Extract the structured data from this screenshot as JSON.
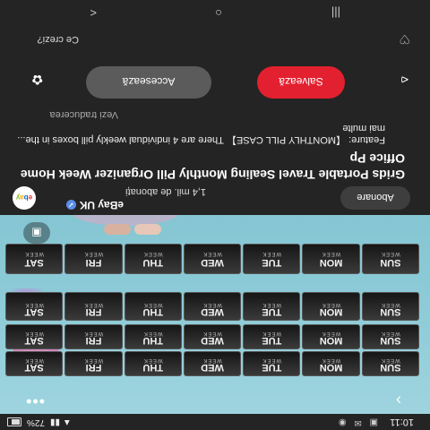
{
  "status_bar": {
    "time": "10:11",
    "notif_icons": "▣ ✉ ◉",
    "battery": "72%",
    "signal": "▲ ▮▮"
  },
  "media": {
    "more_icon": "more-vertical-icon",
    "next_icon": "chevron-right-icon",
    "lens_icon": "lens-icon",
    "rows": [
      {
        "days": [
          "SUN",
          "MON",
          "TUE",
          "WED",
          "THU",
          "FRI",
          "SAT"
        ]
      },
      {
        "days": [
          "SUN",
          "MON",
          "TUE",
          "WED",
          "THU",
          "FRI",
          "SAT"
        ]
      },
      {
        "days": [
          "SUN",
          "MON",
          "TUE",
          "WED",
          "THU",
          "FRI",
          "SAT"
        ]
      },
      {
        "days": [
          "SUN",
          "MON",
          "TUE",
          "WED",
          "THU",
          "FRI",
          "SAT"
        ]
      }
    ],
    "week_label": "WEEK"
  },
  "channel": {
    "name": "eBay UK",
    "verified": "✓",
    "subscribers": "1,4 mil. de abonați",
    "subscribe_label": "Abonare",
    "avatar_letters": [
      "e",
      "b",
      "a",
      "y"
    ]
  },
  "post": {
    "title": "Grids Portable Travel Sealing Monthly Pill Organizer Week Home Office Pp",
    "description": "Feature: 【MONTHLY PILL CASE】 There are 4 individual weekly pill boxes in the... mai multe",
    "translate_link": "Vezi traducerea"
  },
  "actions": {
    "access_label": "Accesează",
    "save_label": "Salvează",
    "share_icon": "share-icon",
    "pinterest_icon": "save-icon"
  },
  "comment": {
    "prompt": "Ce crezi?",
    "heart_icon": "heart-icon"
  },
  "nav_bar": {
    "recents": "|||",
    "home": "○",
    "back": "<"
  }
}
